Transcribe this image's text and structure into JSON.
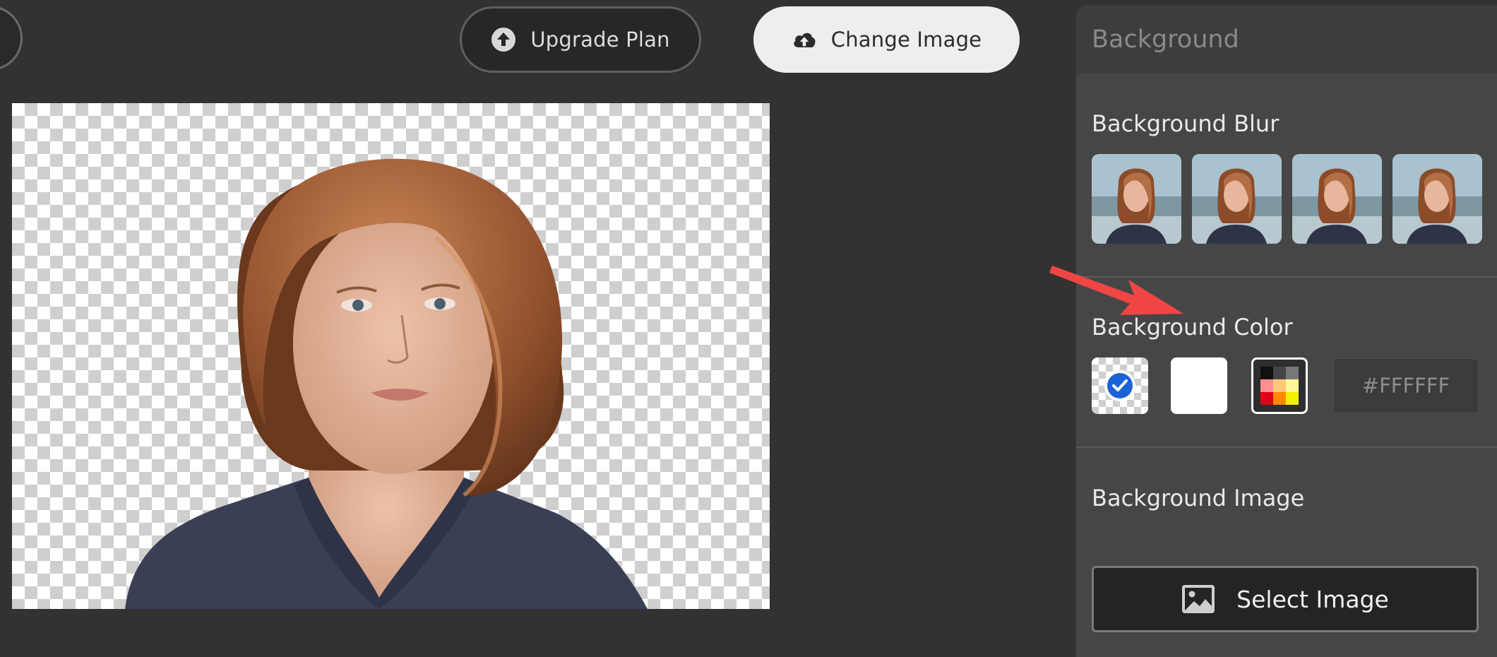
{
  "toolbar": {
    "upgrade_label": "Upgrade Plan",
    "change_image_label": "Change Image"
  },
  "panel": {
    "header_title": "Background",
    "blur": {
      "title": "Background Blur",
      "thumbnails": [
        "blur-preview-1",
        "blur-preview-2",
        "blur-preview-3",
        "blur-preview-4"
      ]
    },
    "color": {
      "title": "Background Color",
      "selected": "transparent",
      "swatches": [
        "transparent",
        "white",
        "color-picker"
      ],
      "hex_placeholder": "#FFFFFF"
    },
    "image": {
      "title": "Background Image",
      "select_label": "Select Image"
    }
  },
  "colors": {
    "app_bg": "#323232",
    "panel_bg": "#464646",
    "accent_check": "#1a62d6",
    "annotation_arrow": "#ef4545"
  },
  "icons": {
    "upgrade": "arrow-up-circle-icon",
    "change_image": "cloud-upload-icon",
    "select_image": "image-icon",
    "selected_swatch": "checkmark-icon"
  }
}
